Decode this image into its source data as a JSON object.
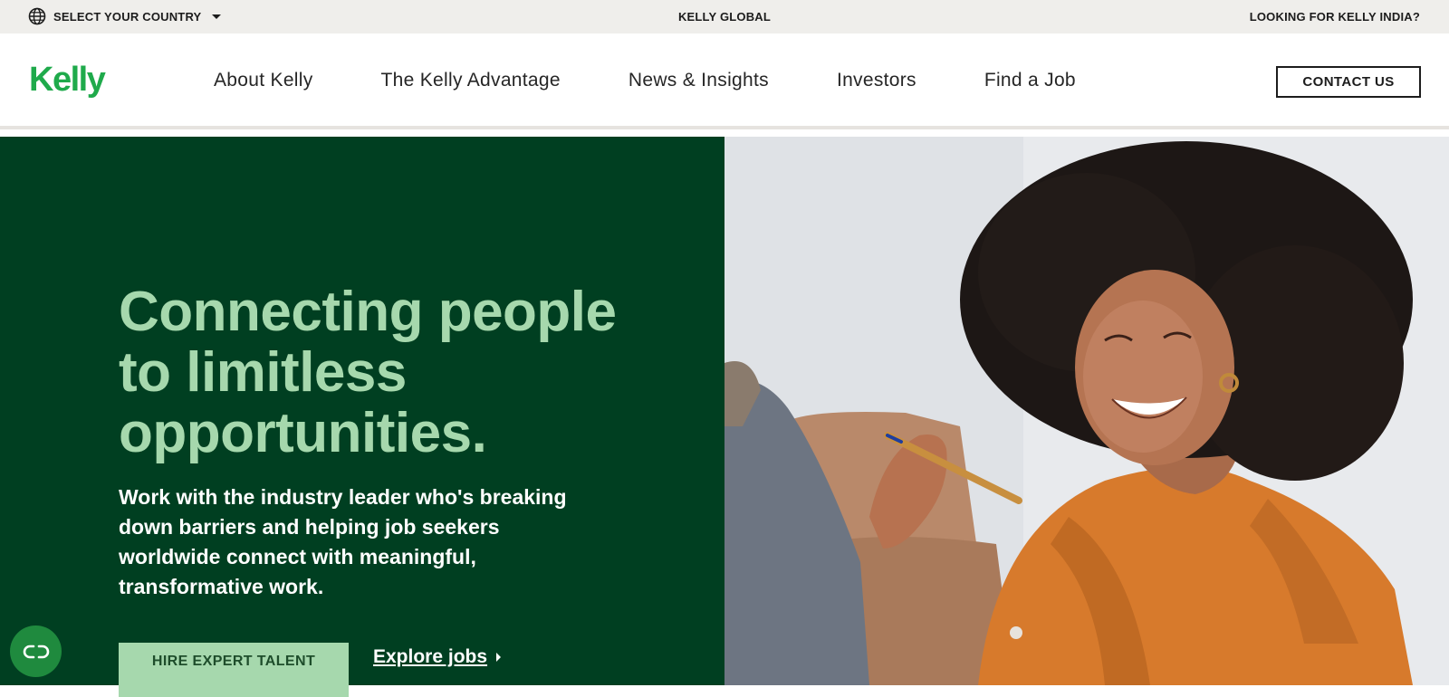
{
  "utility_bar": {
    "country_select_label": "SELECT YOUR COUNTRY",
    "global_label": "KELLY GLOBAL",
    "india_label": "LOOKING FOR KELLY INDIA?",
    "icons": {
      "country": "globe-icon",
      "dropdown": "caret-down-icon"
    }
  },
  "header": {
    "logo_text": "Kelly",
    "nav": [
      {
        "label": "About Kelly"
      },
      {
        "label": "The Kelly Advantage"
      },
      {
        "label": "News & Insights"
      },
      {
        "label": "Investors"
      },
      {
        "label": "Find a Job"
      }
    ],
    "contact_label": "CONTACT US"
  },
  "hero": {
    "title": "Connecting people to limitless opportunities.",
    "body": "Work with the industry leader who's breaking down barriers and helping job seekers worldwide connect with meaningful, transformative work.",
    "primary_cta": "HIRE EXPERT TALENT",
    "secondary_cta": "Explore jobs",
    "image": "hero-photo-smiling-woman-with-pen"
  },
  "chat_widget": {
    "icon": "chat-widget-icon"
  },
  "colors": {
    "brand_green": "#1faa4b",
    "hero_dark_green": "#003f21",
    "hero_title_green": "#a6d8ad",
    "utility_bar_bg": "#efeeeb",
    "chat_green": "#1f8a3e"
  }
}
